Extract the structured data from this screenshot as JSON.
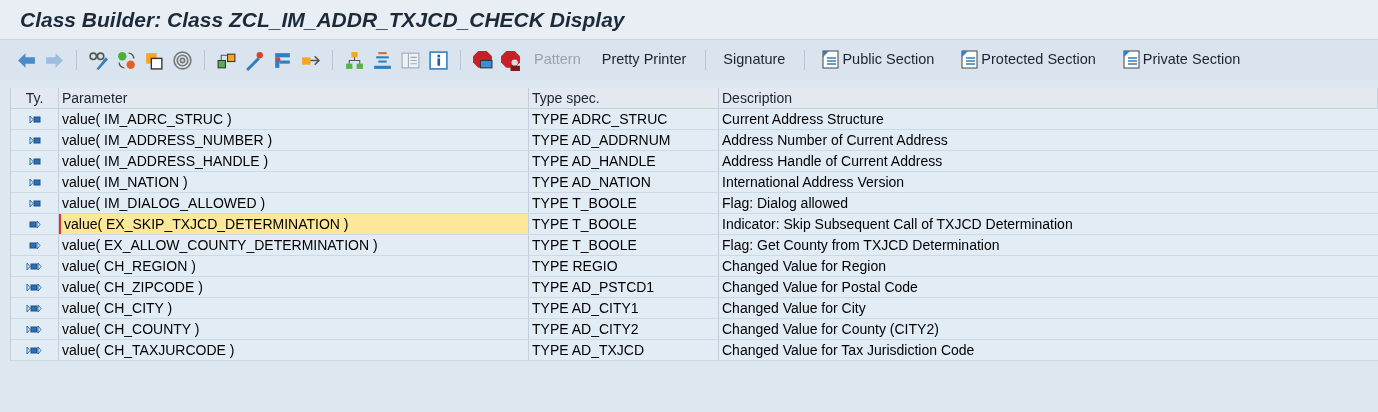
{
  "window": {
    "title": "Class Builder: Class ZCL_IM_ADDR_TXJCD_CHECK Display"
  },
  "toolbar": {
    "buttons": [
      {
        "label": "Pattern",
        "kind": "text",
        "disabled": true
      },
      {
        "label": "Pretty Printer",
        "kind": "text",
        "disabled": false
      },
      {
        "label": "Signature",
        "kind": "text",
        "disabled": false
      },
      {
        "label": "Public Section",
        "kind": "section",
        "disabled": false
      },
      {
        "label": "Protected Section",
        "kind": "section",
        "disabled": false
      },
      {
        "label": "Private Section",
        "kind": "section",
        "disabled": false
      }
    ]
  },
  "table": {
    "columns": [
      "Ty.",
      "Parameter",
      "Type spec.",
      "Description"
    ],
    "rows": [
      {
        "kind": "importing",
        "parameter": "value( IM_ADRC_STRUC )",
        "type_spec": "TYPE ADRC_STRUC",
        "description": "Current Address Structure",
        "selected": false
      },
      {
        "kind": "importing",
        "parameter": "value( IM_ADDRESS_NUMBER )",
        "type_spec": "TYPE AD_ADDRNUM",
        "description": "Address Number of Current Address",
        "selected": false
      },
      {
        "kind": "importing",
        "parameter": "value( IM_ADDRESS_HANDLE )",
        "type_spec": "TYPE AD_HANDLE",
        "description": "Address Handle of Current Address",
        "selected": false
      },
      {
        "kind": "importing",
        "parameter": "value( IM_NATION )",
        "type_spec": "TYPE AD_NATION",
        "description": "International Address Version",
        "selected": false
      },
      {
        "kind": "importing",
        "parameter": "value( IM_DIALOG_ALLOWED )",
        "type_spec": "TYPE T_BOOLE",
        "description": "Flag: Dialog allowed",
        "selected": false
      },
      {
        "kind": "exporting",
        "parameter": "value( EX_SKIP_TXJCD_DETERMINATION )",
        "type_spec": "TYPE T_BOOLE",
        "description": "Indicator: Skip Subsequent Call of TXJCD Determination",
        "selected": true
      },
      {
        "kind": "exporting",
        "parameter": "value( EX_ALLOW_COUNTY_DETERMINATION )",
        "type_spec": "TYPE T_BOOLE",
        "description": "Flag: Get County from TXJCD Determination",
        "selected": false
      },
      {
        "kind": "changing",
        "parameter": "value( CH_REGION )",
        "type_spec": "TYPE REGIO",
        "description": "Changed Value for Region",
        "selected": false
      },
      {
        "kind": "changing",
        "parameter": "value( CH_ZIPCODE )",
        "type_spec": "TYPE AD_PSTCD1",
        "description": "Changed Value for Postal Code",
        "selected": false
      },
      {
        "kind": "changing",
        "parameter": "value( CH_CITY )",
        "type_spec": "TYPE AD_CITY1",
        "description": "Changed Value for City",
        "selected": false
      },
      {
        "kind": "changing",
        "parameter": "value( CH_COUNTY )",
        "type_spec": "TYPE AD_CITY2",
        "description": "Changed Value for County (CITY2)",
        "selected": false
      },
      {
        "kind": "changing",
        "parameter": "value( CH_TAXJURCODE )",
        "type_spec": "TYPE AD_TXJCD",
        "description": "Changed Value for Tax Jurisdiction Code",
        "selected": false
      }
    ]
  }
}
